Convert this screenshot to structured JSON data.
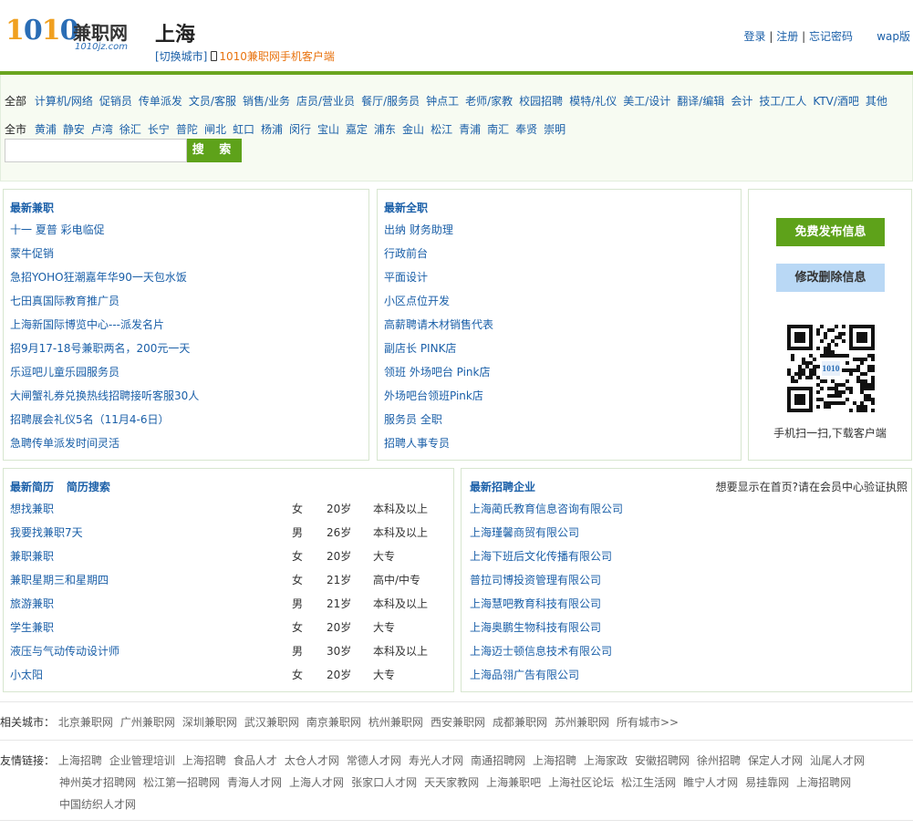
{
  "header": {
    "logo_num": "1010",
    "logo_brand": "兼职网",
    "logo_domain": "1010jz.com",
    "city": "上海",
    "switch_city": "[切换城市]",
    "app_link": "1010兼职网手机客户端",
    "login": "登录",
    "register": "注册",
    "forgot": "忘记密码",
    "sep": "|",
    "wap": "wap版"
  },
  "filter": {
    "cat_all": "全部",
    "categories": [
      "计算机/网络",
      "促销员",
      "传单派发",
      "文员/客服",
      "销售/业务",
      "店员/营业员",
      "餐厅/服务员",
      "钟点工",
      "老师/家教",
      "校园招聘",
      "模特/礼仪",
      "美工/设计",
      "翻译/编辑",
      "会计",
      "技工/工人",
      "KTV/酒吧",
      "其他"
    ],
    "area_all": "全市",
    "areas": [
      "黄浦",
      "静安",
      "卢湾",
      "徐汇",
      "长宁",
      "普陀",
      "闸北",
      "虹口",
      "杨浦",
      "闵行",
      "宝山",
      "嘉定",
      "浦东",
      "金山",
      "松江",
      "青浦",
      "南汇",
      "奉贤",
      "崇明"
    ],
    "search_button": "搜 索",
    "search_value": ""
  },
  "parttime": {
    "title": "最新兼职",
    "items": [
      "十一 夏普 彩电临促",
      "蒙牛促销",
      "急招YOHO狂潮嘉年华90一天包水饭",
      "七田真国际教育推广员",
      "上海新国际博览中心---派发名片",
      "招9月17-18号兼职两名，200元一天",
      "乐逗吧儿童乐园服务员",
      "大闸蟹礼券兑换热线招聘接听客服30人",
      "招聘展会礼仪5名（11月4-6日）",
      "急聘传单派发时间灵活"
    ]
  },
  "fulltime": {
    "title": "最新全职",
    "items": [
      "出纳 财务助理",
      "行政前台",
      "平面设计",
      "小区点位开发",
      "高薪聘请木材销售代表",
      "副店长 PINK店",
      "领班 外场吧台 Pink店",
      "外场吧台领班Pink店",
      "服务员 全职",
      "招聘人事专员"
    ]
  },
  "side": {
    "publish": "免费发布信息",
    "edit": "修改删除信息",
    "qr_caption": "手机扫一扫,下载客户端",
    "qr_logo": "1010"
  },
  "resumes": {
    "title": "最新简历",
    "search": "简历搜索",
    "rows": [
      {
        "name": "想找兼职",
        "gender": "女",
        "age": "20岁",
        "edu": "本科及以上"
      },
      {
        "name": "我要找兼职7天",
        "gender": "男",
        "age": "26岁",
        "edu": "本科及以上"
      },
      {
        "name": "兼职兼职",
        "gender": "女",
        "age": "20岁",
        "edu": "大专"
      },
      {
        "name": "兼职星期三和星期四",
        "gender": "女",
        "age": "21岁",
        "edu": "高中/中专"
      },
      {
        "name": "旅游兼职",
        "gender": "男",
        "age": "21岁",
        "edu": "本科及以上"
      },
      {
        "name": "学生兼职",
        "gender": "女",
        "age": "20岁",
        "edu": "大专"
      },
      {
        "name": "液压与气动传动设计师",
        "gender": "男",
        "age": "30岁",
        "edu": "本科及以上"
      },
      {
        "name": "小太阳",
        "gender": "女",
        "age": "20岁",
        "edu": "大专"
      }
    ]
  },
  "companies": {
    "title": "最新招聘企业",
    "note": "想要显示在首页?请在会员中心验证执照",
    "items": [
      "上海蔺氏教育信息咨询有限公司",
      "上海瑾馨商贸有限公司",
      "上海下班后文化传播有限公司",
      "普拉司博投资管理有限公司",
      "上海慧吧教育科技有限公司",
      "上海奥鹏生物科技有限公司",
      "上海迈士顿信息技术有限公司",
      "上海品翎广告有限公司"
    ]
  },
  "related": {
    "label": "相关城市：",
    "items": [
      "北京兼职网",
      "广州兼职网",
      "深圳兼职网",
      "武汉兼职网",
      "南京兼职网",
      "杭州兼职网",
      "西安兼职网",
      "成都兼职网",
      "苏州兼职网",
      "所有城市>>"
    ]
  },
  "friends": {
    "label": "友情链接：",
    "row1": [
      "上海招聘",
      "企业管理培训",
      "上海招聘",
      "食品人才",
      "太仓人才网",
      "常德人才网",
      "寿光人才网",
      "南通招聘网",
      "上海招聘",
      "上海家政",
      "安徽招聘网",
      "徐州招聘",
      "保定人才网",
      "汕尾人才网"
    ],
    "row2": [
      "神州英才招聘网",
      "松江第一招聘网",
      "青海人才网",
      "上海人才网",
      "张家口人才网",
      "天天家教网",
      "上海兼职吧",
      "上海社区论坛",
      "松江生活网",
      "睢宁人才网",
      "易挂靠网",
      "上海招聘网"
    ],
    "row3": [
      "中国纺织人才网"
    ]
  },
  "colors": {
    "accent_green": "#5ea21a",
    "link_blue": "#1a5fa8",
    "app_orange": "#e8730f"
  }
}
